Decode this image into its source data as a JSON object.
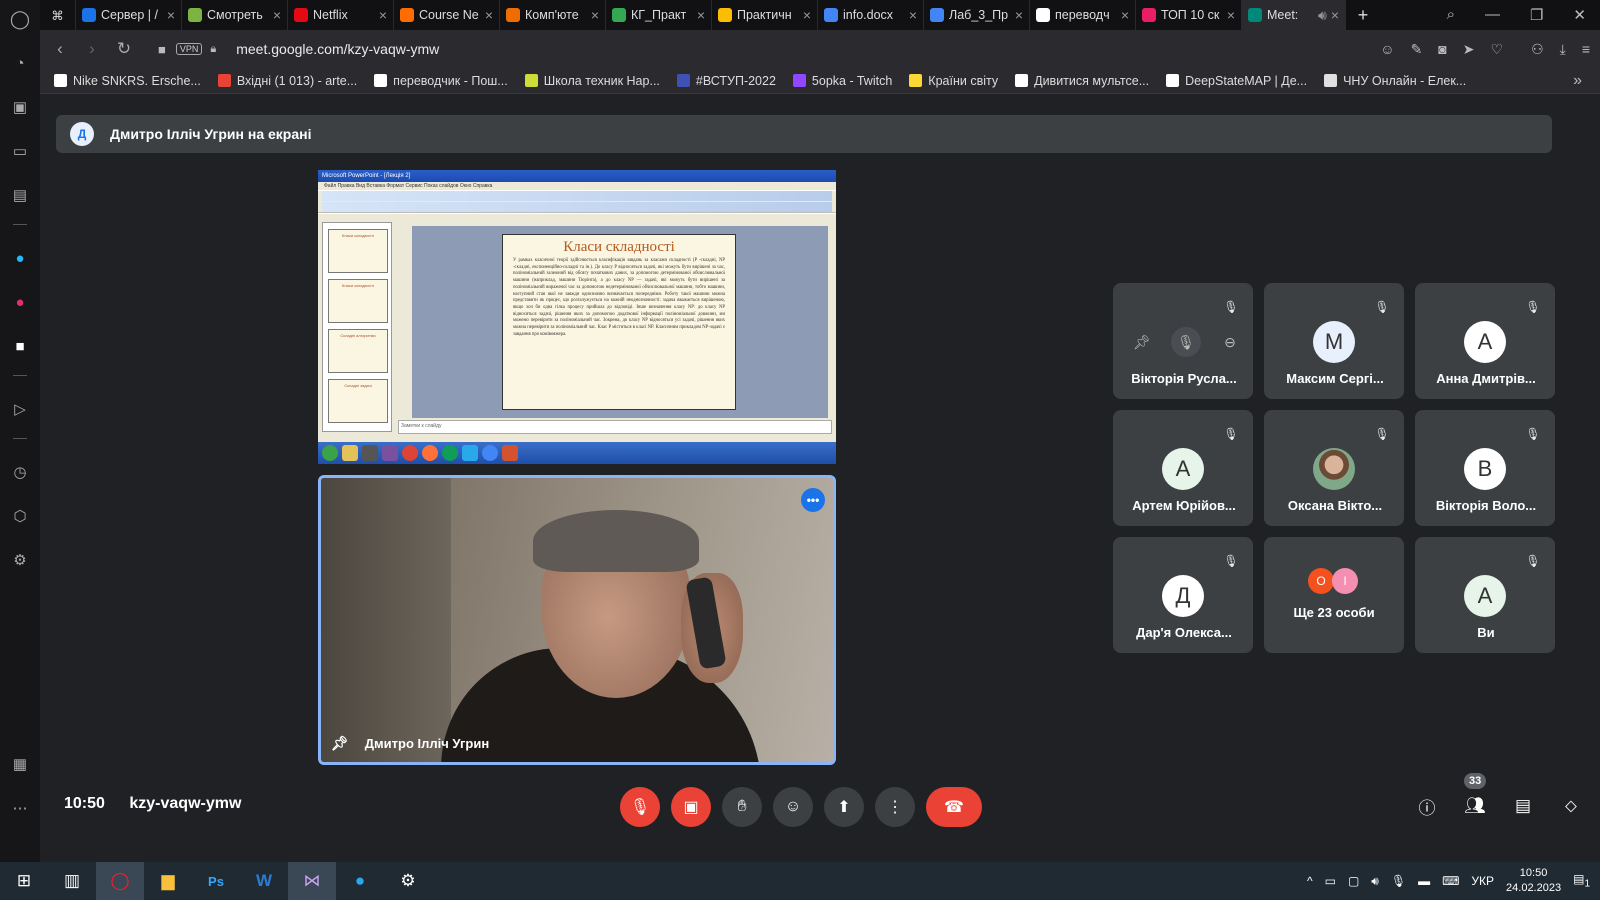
{
  "browser": {
    "tabs": [
      {
        "label": "Сервер | /",
        "color": "#1a73e8"
      },
      {
        "label": "Смотреть",
        "color": "#7cb342"
      },
      {
        "label": "Netflix",
        "color": "#e50914"
      },
      {
        "label": "Course Ne",
        "color": "#ff6d00"
      },
      {
        "label": "Комп'ютe",
        "color": "#ef6c00"
      },
      {
        "label": "КГ_Практ",
        "color": "#34a853"
      },
      {
        "label": "Практичн",
        "color": "#fbbc04"
      },
      {
        "label": "info.docx",
        "color": "#4285f4"
      },
      {
        "label": "Лаб_3_Пр",
        "color": "#4285f4"
      },
      {
        "label": "переводч",
        "color": "#ffffff"
      },
      {
        "label": "ТОП 10 ск",
        "color": "#e91e63"
      },
      {
        "label": "Meet:",
        "color": "#00897b"
      }
    ],
    "url": "meet.google.com/kzy-vaqw-ymw",
    "vpn_label": "VPN",
    "bookmarks": [
      {
        "label": "Nike SNKRS. Ersche...",
        "color": "#ffffff"
      },
      {
        "label": "Вхідні (1 013) - arte...",
        "color": "#ea4335"
      },
      {
        "label": "переводчик - Пош...",
        "color": "#ffffff"
      },
      {
        "label": "Школа техник Нар...",
        "color": "#cddc39"
      },
      {
        "label": "#ВСТУП-2022",
        "color": "#3f51b5"
      },
      {
        "label": "5opka - Twitch",
        "color": "#9146ff"
      },
      {
        "label": "Країни світу",
        "color": "#fdd835"
      },
      {
        "label": "Дивитися мультсе...",
        "color": "#ffffff"
      },
      {
        "label": "DeepStateMAP | Де...",
        "color": "#ffffff"
      },
      {
        "label": "ЧНУ Онлайн - Елек...",
        "color": "#e0e0e0"
      }
    ]
  },
  "meet": {
    "presenter_banner": "Дмитро Ілліч Угрин на екрані",
    "presenter_initial": "Д",
    "screen_share": {
      "app_title": "Microsoft PowerPoint - [Лекція 2]",
      "menu": "Файл  Правка  Вид  Вставка  Формат  Сервис  Показ слайдов  Окно  Справка",
      "slide_title": "Класи складності",
      "slide_body": "У рамках класичної теорії здійснюється класифікація завдань за класами складності (P -складні, NP -складні, експоненційно-складні та ін.). До класу P відносяться задачі, які можуть бути вирішені за час, поліноміальний залежний від обсягу початкових даних, за допомогою детермінованої обчислювальної машини (наприклад, машини Тюрінга), а до класу NP — задачі, які можуть бути вирішені за поліноміальний вираженої час за допомогою недетермінованої обчислювальної машини, тобто машини, наступний стан якої не завжди однозначно визначається попередніми. Роботу такої машини можна представити як процес, що розгалужується на кожній неоднозначності: задача вважається вирішеною, якщо хоч би одна гілка процесу прийшла до відповіді. Інше визначення класу NP: до класу NP відносяться задачі, рішення яких за допомогою додаткової інформації поліноміальної довжини, ми можемо перевірити за поліноміальний час. Зокрема, до класу NP відносяться усі задачі, рішення яких можна перевірити за поліноміальний час. Клас P міститься в класі NP. Класичним прикладом NP-задачі є завдання про комівояжера.",
      "notes_placeholder": "Заметки к слайду",
      "thumb_titles": [
        "Класи складності",
        "Класи складності",
        "Складні алгоритми",
        "Складні задачі"
      ]
    },
    "camera": {
      "name": "Дмитро Ілліч Угрин"
    },
    "participants": [
      {
        "name": "Вікторія Русла...",
        "initial": "",
        "color": "",
        "muted": true,
        "hover": true
      },
      {
        "name": "Максим Сергі...",
        "initial": "М",
        "color": "#e8f0fe",
        "muted": true
      },
      {
        "name": "Анна Дмитрів...",
        "initial": "А",
        "color": "#ffffff",
        "muted": true
      },
      {
        "name": "Артем Юрійов...",
        "initial": "А",
        "color": "#e6f4ea",
        "muted": true
      },
      {
        "name": "Оксана Вікто...",
        "initial": "",
        "color": "#7fa889",
        "muted": true,
        "photo": true
      },
      {
        "name": "Вікторія Воло...",
        "initial": "В",
        "color": "#ffffff",
        "muted": true
      },
      {
        "name": "Дар'я Олекса...",
        "initial": "Д",
        "color": "#ffffff",
        "muted": true
      },
      {
        "name": "Ще 23 особи",
        "initial": "",
        "color": "",
        "muted": false,
        "more": true,
        "more_initials": [
          "O",
          "I"
        ],
        "more_colors": [
          "#f4511e",
          "#f48fb1"
        ]
      },
      {
        "name": "Ви",
        "initial": "А",
        "color": "#e6f4ea",
        "muted": true
      }
    ],
    "controls": {
      "time": "10:50",
      "meeting_code": "kzy-vaqw-ymw",
      "people_count": "33"
    }
  },
  "taskbar": {
    "lang": "УКР",
    "time": "10:50",
    "date": "24.02.2023",
    "notifications": "1"
  },
  "colors": {
    "meet_bg": "#202124",
    "tile_bg": "#3c4043",
    "danger": "#ea4335",
    "accent": "#8ab4f8"
  }
}
